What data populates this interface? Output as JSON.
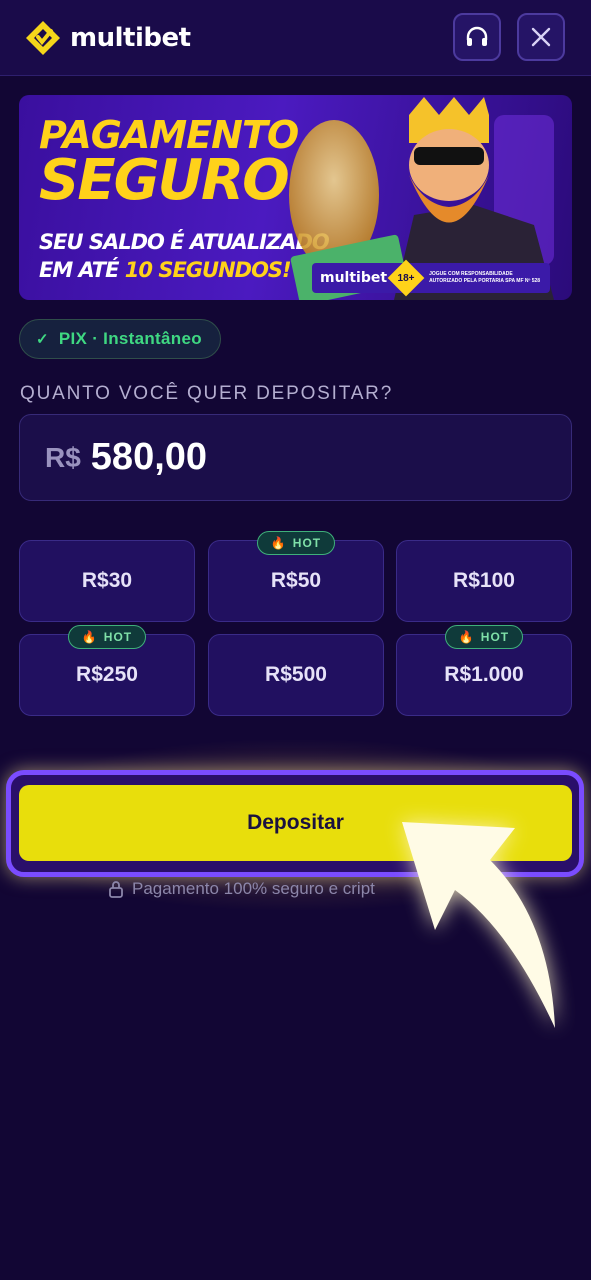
{
  "brand": {
    "name": "multibet",
    "accent": "#f5d61a",
    "background": "#120634"
  },
  "header": {
    "support_icon": "headset-icon",
    "close_icon": "close-icon"
  },
  "banner": {
    "line1": "PAGAMENTO",
    "line2": "SEGURO",
    "line3": "SEU SALDO É ATUALIZADO",
    "line4_prefix": "EM ATÉ ",
    "line4_highlight": "10 SEGUNDOS!",
    "mini_brand": "multibet",
    "age_badge": "18+",
    "responsibility_1": "JOGUE COM RESPONSABILIDADE",
    "responsibility_2": "AUTORIZADO PELA PORTARIA SPA MF Nº 528"
  },
  "payment_method": {
    "label": "PIX · Instantâneo",
    "icon": "check-icon"
  },
  "deposit": {
    "question": "QUANTO VOCÊ QUER DEPOSITAR?",
    "currency": "R$",
    "amount": "580,00"
  },
  "quick_amounts": [
    {
      "label": "R$30",
      "hot": false
    },
    {
      "label": "R$50",
      "hot": true
    },
    {
      "label": "R$100",
      "hot": false
    },
    {
      "label": "R$250",
      "hot": true
    },
    {
      "label": "R$500",
      "hot": false
    },
    {
      "label": "R$1.000",
      "hot": true
    }
  ],
  "hot_label": "HOT",
  "submit": {
    "label": "Depositar",
    "color": "#e8de0c"
  },
  "security_note": "Pagamento 100% seguro e cript"
}
